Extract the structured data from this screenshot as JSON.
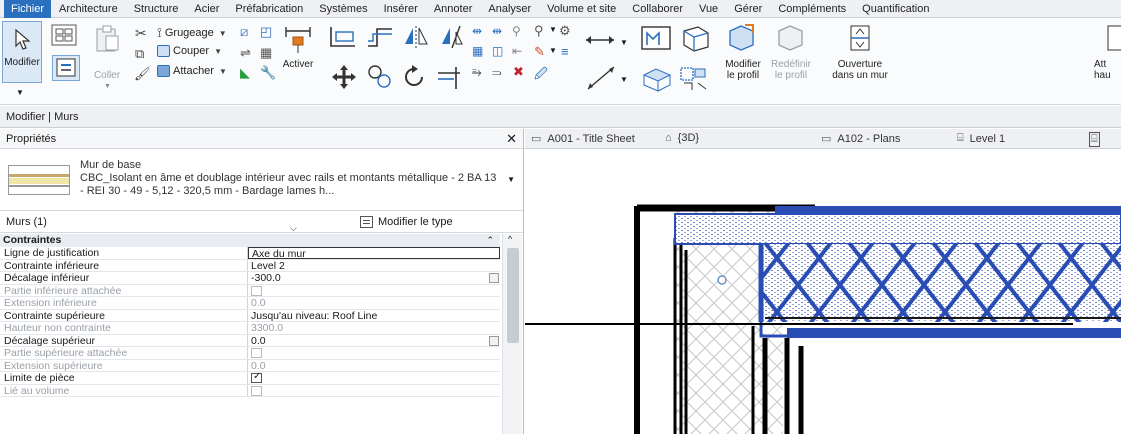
{
  "menu": [
    "Fichier",
    "Architecture",
    "Structure",
    "Acier",
    "Préfabrication",
    "Systèmes",
    "Insérer",
    "Annoter",
    "Analyser",
    "Volume et site",
    "Collaborer",
    "Vue",
    "Gérer",
    "Compléments",
    "Quantification"
  ],
  "ribbon": {
    "modifier": "Modifier",
    "coller": "Coller",
    "grugeage": "Grugeage",
    "couper": "Couper",
    "attacher": "Attacher",
    "activer": "Activer",
    "modifier_profil": [
      "Modifier",
      "le profil"
    ],
    "redefinir_profil": [
      "Redéfinir",
      "le profil"
    ],
    "ouverture": [
      "Ouverture",
      "dans un mur"
    ],
    "att_partial": [
      "Att",
      "hau"
    ]
  },
  "context_bar": "Modifier | Murs",
  "properties": {
    "title": "Propriétés",
    "close": "✕",
    "type_name": "Mur de base",
    "type_desc": "CBC_Isolant en âme et doublage intérieur avec rails et montants métallique - 2 BA 13 - REI 30  - 49  - 5,12  - 320,5 mm - Bardage lames h...",
    "instance": "Murs (1)",
    "edit_type": "Modifier le type",
    "group": "Contraintes",
    "rows": [
      {
        "name": "Ligne de justification",
        "value": "Axe du mur",
        "state": "editing"
      },
      {
        "name": "Contrainte inférieure",
        "value": "Level 2",
        "state": "normal"
      },
      {
        "name": "Décalage inférieur",
        "value": "-300.0",
        "state": "button"
      },
      {
        "name": "Partie inférieure attachée",
        "value": "",
        "state": "dim-bool"
      },
      {
        "name": "Extension inférieure",
        "value": "0.0",
        "state": "dim"
      },
      {
        "name": "Contrainte supérieure",
        "value": "Jusqu'au niveau: Roof Line",
        "state": "normal"
      },
      {
        "name": "Hauteur non contrainte",
        "value": "3300.0",
        "state": "dim"
      },
      {
        "name": "Décalage supérieur",
        "value": "0.0",
        "state": "button"
      },
      {
        "name": "Partie supérieure attachée",
        "value": "",
        "state": "dim-bool"
      },
      {
        "name": "Extension supérieure",
        "value": "0.0",
        "state": "dim"
      },
      {
        "name": "Limite de pièce",
        "value": "",
        "state": "bool-on"
      },
      {
        "name": "Lié au volume",
        "value": "",
        "state": "dim-bool"
      }
    ]
  },
  "view_tabs": [
    "A001 - Title Sheet",
    "{3D}",
    "A102 - Plans",
    "Level 1"
  ],
  "colors": {
    "accent": "#2b6fbf",
    "wall_blue": "#2a4db5"
  }
}
